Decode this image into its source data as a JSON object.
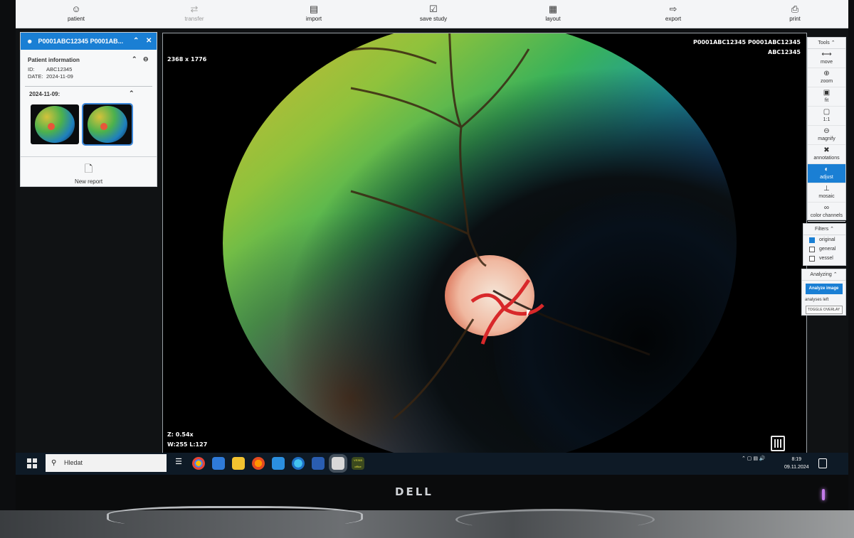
{
  "toolbar": {
    "items": [
      {
        "label": "patient",
        "icon": "person-icon"
      },
      {
        "label": "transfer",
        "icon": "transfer-icon"
      },
      {
        "label": "import",
        "icon": "import-icon"
      },
      {
        "label": "save study",
        "icon": "save-study-icon"
      },
      {
        "label": "layout",
        "icon": "grid-icon"
      },
      {
        "label": "export",
        "icon": "export-icon"
      },
      {
        "label": "print",
        "icon": "print-icon"
      }
    ]
  },
  "patient_panel": {
    "header": "P0001ABC12345 P0001AB...",
    "info_title": "Patient information",
    "id_label": "ID:",
    "id_value": "ABC12345",
    "date_label": "DATE:",
    "date_value": "2024-11-09",
    "study_date": "2024-11-09:",
    "new_report": "New report"
  },
  "viewer": {
    "dimensions": "2368 x 1776",
    "patient_line": "P0001ABC12345 P0001ABC12345",
    "patient_id": "ABC12345",
    "zoom": "Z: 0.54x",
    "window_level": "W:255 L:127"
  },
  "tools_panel": {
    "title": "Tools",
    "tools": [
      {
        "label": "move",
        "icon": "move-icon",
        "active": false
      },
      {
        "label": "zoom",
        "icon": "zoom-icon",
        "active": false
      },
      {
        "label": "fit",
        "icon": "fit-icon",
        "active": false
      },
      {
        "label": "1:1",
        "icon": "actual-size-icon",
        "active": false
      },
      {
        "label": "magnify",
        "icon": "magnify-icon",
        "active": false
      },
      {
        "label": "annotations",
        "icon": "annotations-icon",
        "active": false
      },
      {
        "label": "adjust",
        "icon": "adjust-icon",
        "active": true
      },
      {
        "label": "mosaic",
        "icon": "mosaic-icon",
        "active": false
      },
      {
        "label": "color channels",
        "icon": "color-channels-icon",
        "active": false
      }
    ]
  },
  "filters_panel": {
    "title": "Filters",
    "filters": [
      {
        "label": "original",
        "checked": true
      },
      {
        "label": "general",
        "checked": false
      },
      {
        "label": "vessel",
        "checked": false
      }
    ]
  },
  "analyzing_panel": {
    "title": "Analyzing",
    "button": "Analyze image",
    "analyses_left": "analyses left",
    "overlay_button": "TOGGLE OVERLAY"
  },
  "taskbar": {
    "search_placeholder": "Hledat",
    "time": "8:19",
    "date": "09.11.2024",
    "active_app_label": "VS365 office"
  },
  "monitor": {
    "brand": "DELL"
  },
  "colors": {
    "accent": "#1a7fd4",
    "taskbar": "#0e1a26"
  }
}
